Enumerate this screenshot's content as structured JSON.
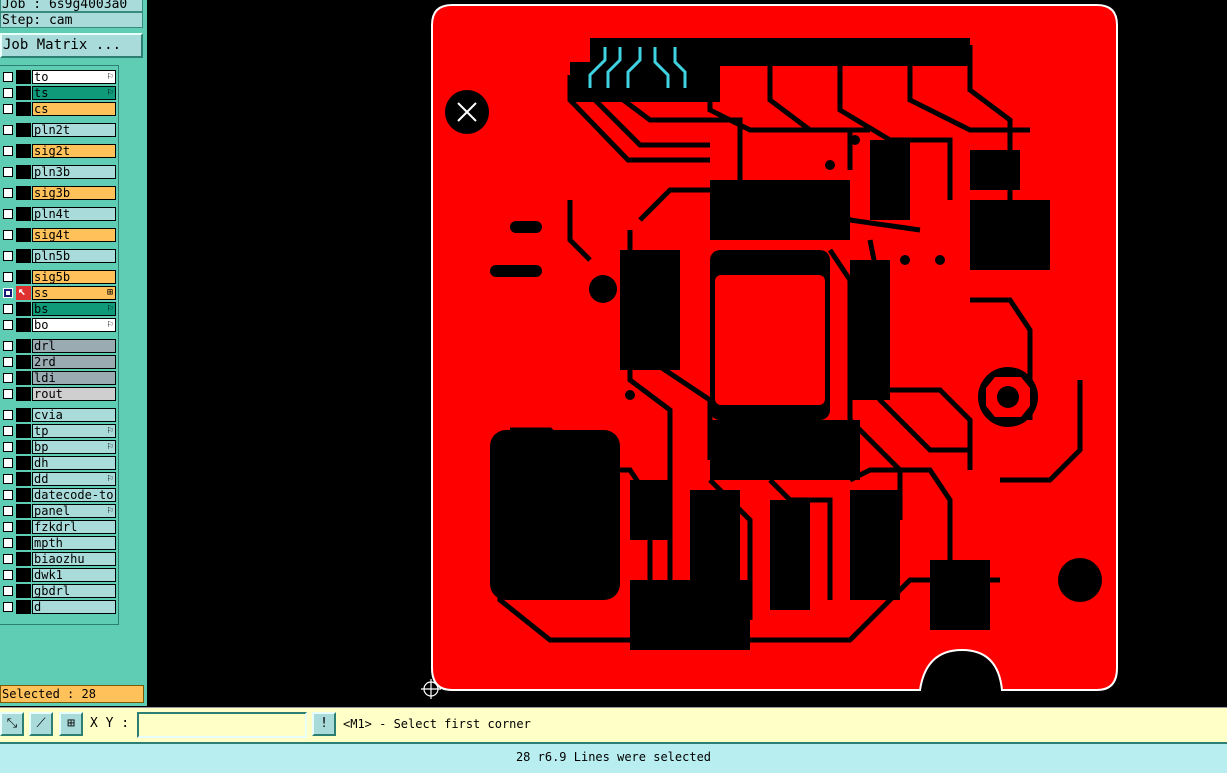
{
  "header": {
    "job": "Job : 6s9g4003a0",
    "step": "Step: cam",
    "job_matrix": "Job Matrix ..."
  },
  "layers": [
    {
      "name": "to",
      "color": "white",
      "flag": "⚐"
    },
    {
      "name": "ts",
      "color": "green",
      "flag": "⚐"
    },
    {
      "name": "cs",
      "color": "orange",
      "flag": ""
    },
    {
      "name": "pln2t",
      "color": "blue",
      "flag": ""
    },
    {
      "name": "sig2t",
      "color": "orange",
      "flag": ""
    },
    {
      "name": "pln3b",
      "color": "blue",
      "flag": ""
    },
    {
      "name": "sig3b",
      "color": "orange",
      "flag": ""
    },
    {
      "name": "pln4t",
      "color": "blue",
      "flag": ""
    },
    {
      "name": "sig4t",
      "color": "orange",
      "flag": ""
    },
    {
      "name": "pln5b",
      "color": "blue",
      "flag": ""
    },
    {
      "name": "sig5b",
      "color": "orange",
      "flag": ""
    },
    {
      "name": "ss",
      "color": "orange",
      "flag": "⊞",
      "work": true
    },
    {
      "name": "bs",
      "color": "green",
      "flag": "⚐"
    },
    {
      "name": "bo",
      "color": "white",
      "flag": "⚐"
    },
    {
      "name": "drl",
      "color": "gray",
      "flag": ""
    },
    {
      "name": "2rd",
      "color": "gray",
      "flag": ""
    },
    {
      "name": "ldi",
      "color": "gray",
      "flag": ""
    },
    {
      "name": "rout",
      "color": "lgray",
      "flag": ""
    },
    {
      "name": "cvia",
      "color": "blue",
      "flag": ""
    },
    {
      "name": "tp",
      "color": "blue",
      "flag": "⚐"
    },
    {
      "name": "bp",
      "color": "blue",
      "flag": "⚐"
    },
    {
      "name": "dh",
      "color": "blue",
      "flag": ""
    },
    {
      "name": "dd",
      "color": "blue",
      "flag": "⚐"
    },
    {
      "name": "datecode-to",
      "color": "blue",
      "flag": ""
    },
    {
      "name": "panel",
      "color": "blue",
      "flag": "⚐"
    },
    {
      "name": "fzkdrl",
      "color": "blue",
      "flag": ""
    },
    {
      "name": "mpth",
      "color": "blue",
      "flag": ""
    },
    {
      "name": "biaozhu",
      "color": "blue",
      "flag": ""
    },
    {
      "name": "dwk1",
      "color": "blue",
      "flag": ""
    },
    {
      "name": "gbdrl",
      "color": "blue",
      "flag": ""
    },
    {
      "name": "d",
      "color": "blue",
      "flag": ""
    }
  ],
  "selected": "Selected : 28",
  "toolbar": {
    "xy_label": "X Y :",
    "xy_value": "",
    "excl": "!",
    "prompt": "<M1> - Select first corner"
  },
  "status": "28 r6.9 Lines were selected",
  "colors": {
    "copper": "#ff0000",
    "background": "#000000",
    "highlight": "#3fd2e0",
    "outline": "#ffffff"
  }
}
